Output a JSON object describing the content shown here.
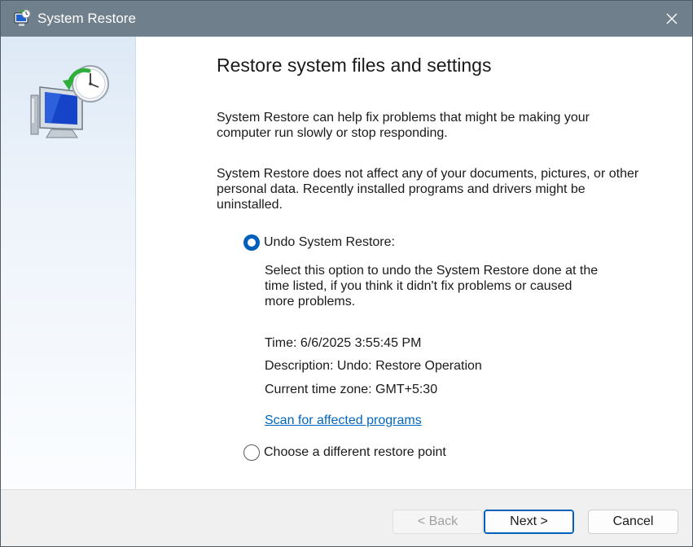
{
  "window": {
    "title": "System Restore",
    "icon": "system-restore-icon",
    "accent_color": "#005fb8",
    "titlebar_color": "#6f7f8b"
  },
  "main": {
    "heading": "Restore system files and settings",
    "paragraph1_lines": [
      "System Restore can help fix problems that might be making your",
      "computer run slowly or stop responding."
    ],
    "paragraph2_lines": [
      "System Restore does not affect any of your documents, pictures, or other",
      "personal data. Recently installed programs and drivers might be",
      "uninstalled."
    ],
    "undo_option": {
      "label": "Undo System Restore:",
      "selected": true,
      "description_lines": [
        "Select this option to undo the System Restore done at the",
        "time listed, if you think it didn't fix problems or caused",
        "more problems."
      ],
      "time": "Time: 6/6/2025 3:55:45 PM",
      "description": "Description: Undo: Restore Operation",
      "timezone": "Current time zone: GMT+5:30",
      "scan_link": "Scan for affected programs"
    },
    "choose_option": {
      "label": "Choose a different restore point",
      "selected": false
    }
  },
  "footer": {
    "back_label": "< Back",
    "next_label": "Next >",
    "cancel_label": "Cancel"
  }
}
